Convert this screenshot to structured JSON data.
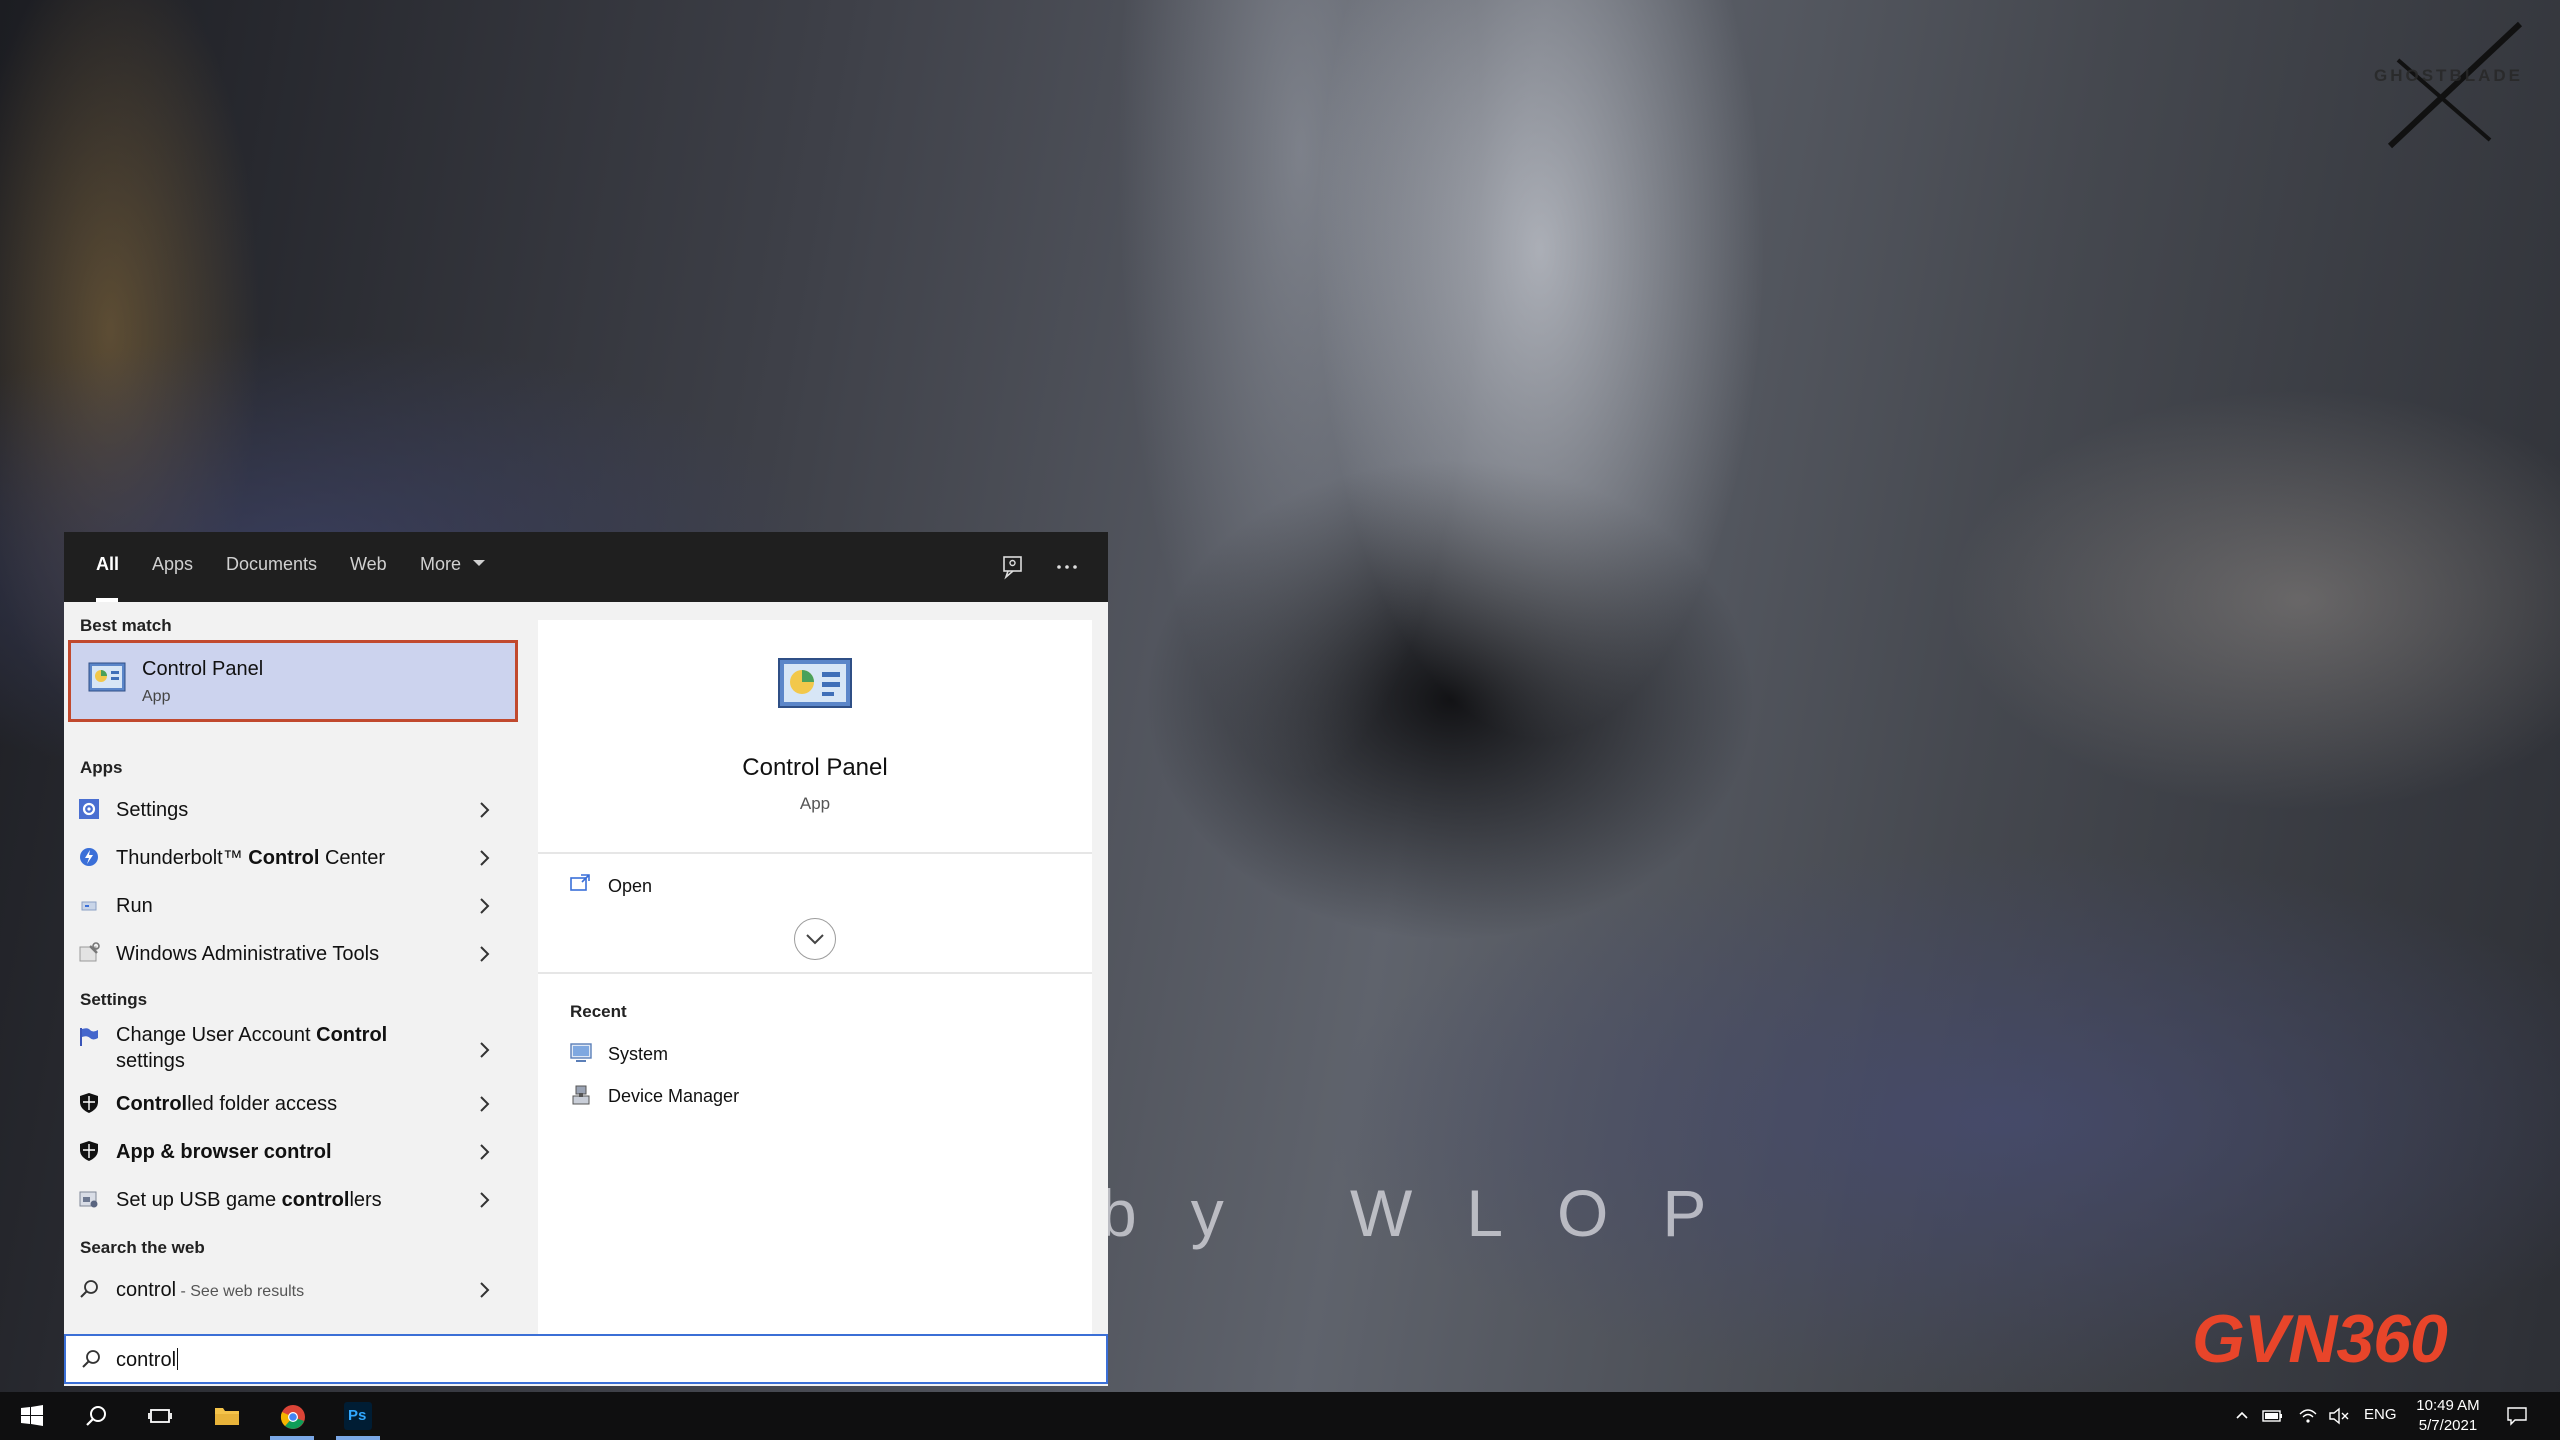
{
  "wallpaper": {
    "signature_text": "by WLOP",
    "corner_logo_text": "GHOSTBLADE",
    "brand_watermark": "GVN360"
  },
  "search_tabs": {
    "items": [
      "All",
      "Apps",
      "Documents",
      "Web",
      "More"
    ],
    "active": "All"
  },
  "best_match": {
    "header": "Best match",
    "title": "Control Panel",
    "subtitle": "App"
  },
  "apps_section": {
    "header": "Apps",
    "items": [
      {
        "pre": "Settings",
        "bold": "",
        "post": ""
      },
      {
        "pre": "Thunderbolt™ ",
        "bold": "Control",
        "post": " Center"
      },
      {
        "pre": "Run",
        "bold": "",
        "post": ""
      },
      {
        "pre": "Windows Administrative Tools",
        "bold": "",
        "post": ""
      }
    ]
  },
  "settings_section": {
    "header": "Settings",
    "items": [
      {
        "pre": "Change User Account ",
        "bold": "Control",
        "post": "",
        "line2": "settings"
      },
      {
        "pre": "",
        "bold": "Control",
        "post": "led folder access"
      },
      {
        "pre": "",
        "bold": "App & browser control",
        "post": ""
      },
      {
        "pre": "Set up USB game ",
        "bold": "control",
        "post": "lers"
      }
    ]
  },
  "web_section": {
    "header": "Search the web",
    "query": "control",
    "suffix": " - See web results"
  },
  "detail_pane": {
    "title": "Control Panel",
    "subtitle": "App",
    "open_label": "Open",
    "recent_header": "Recent",
    "recent_items": [
      "System",
      "Device Manager"
    ]
  },
  "search_box": {
    "value": "control"
  },
  "taskbar": {
    "language": "ENG",
    "time": "10:49 AM",
    "date": "5/7/2021",
    "ps_label": "Ps"
  },
  "colors": {
    "accent_highlight": "#ccd3ee",
    "best_match_border": "#c1492e",
    "search_border": "#3b6fd6",
    "tab_bar": "#1f1f1f",
    "taskbar": "#0f0f10"
  }
}
